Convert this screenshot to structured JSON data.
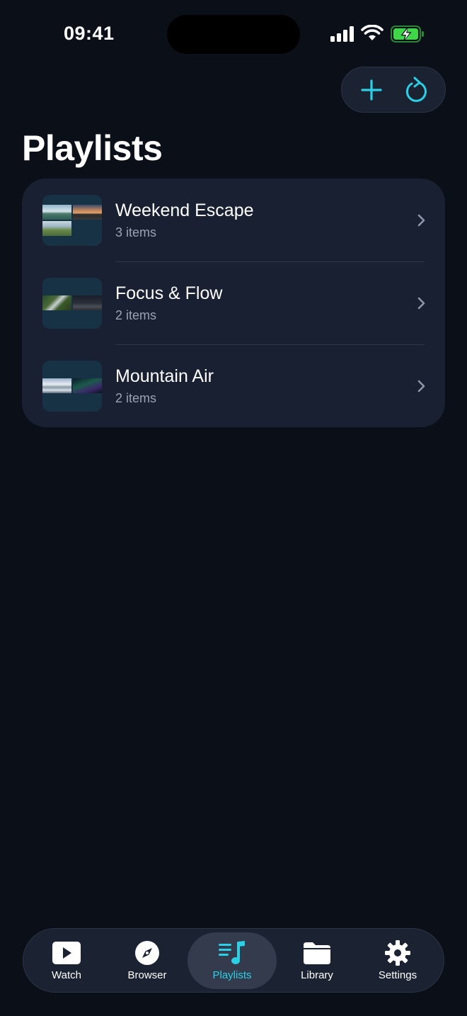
{
  "status_bar": {
    "time": "09:41"
  },
  "header": {
    "title": "Playlists"
  },
  "colors": {
    "accent": "#2ad0e6",
    "background": "#0b0f18",
    "card": "#182032",
    "battery": "#3fd64a"
  },
  "playlists": [
    {
      "title": "Weekend Escape",
      "subtitle": "3 items"
    },
    {
      "title": "Focus & Flow",
      "subtitle": "2 items"
    },
    {
      "title": "Mountain Air",
      "subtitle": "2 items"
    }
  ],
  "tabs": [
    {
      "label": "Watch",
      "icon": "play-icon",
      "active": false
    },
    {
      "label": "Browser",
      "icon": "compass-icon",
      "active": false
    },
    {
      "label": "Playlists",
      "icon": "music-list-icon",
      "active": true
    },
    {
      "label": "Library",
      "icon": "folder-icon",
      "active": false
    },
    {
      "label": "Settings",
      "icon": "gear-icon",
      "active": false
    }
  ],
  "actions": [
    {
      "icon": "plus-icon"
    },
    {
      "icon": "refresh-icon"
    }
  ]
}
